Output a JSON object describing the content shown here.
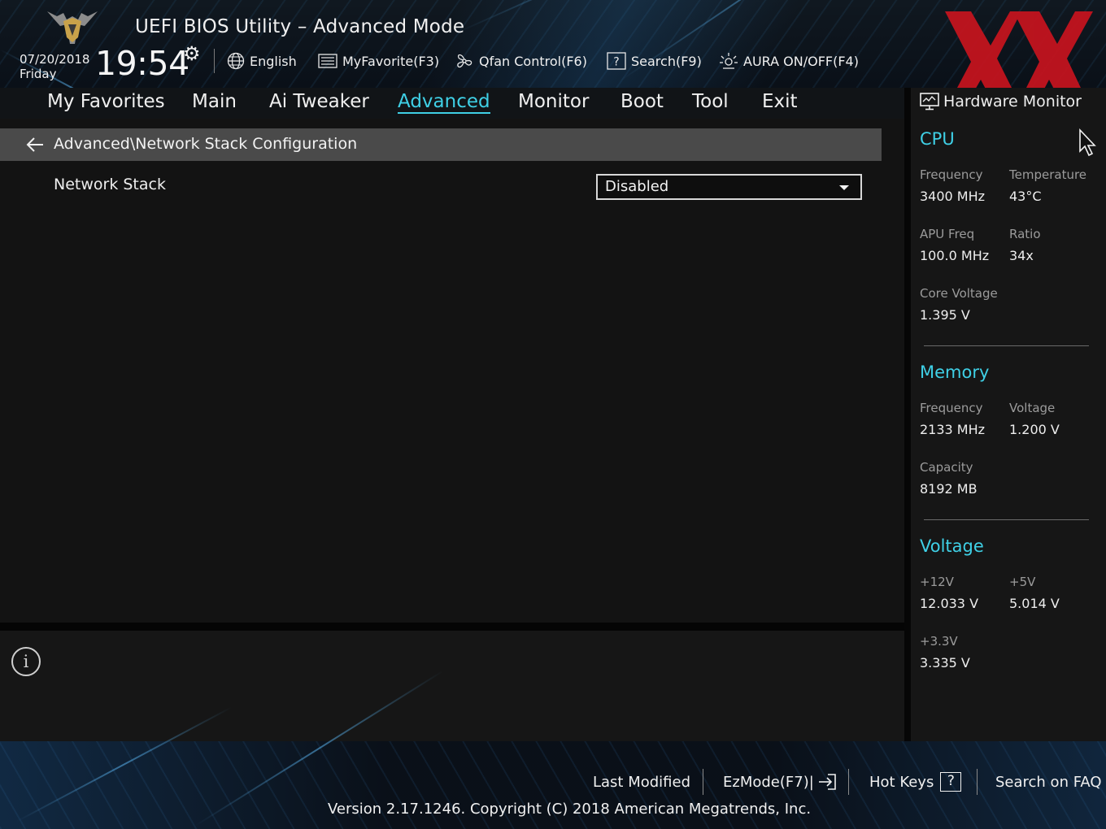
{
  "header": {
    "title": "UEFI BIOS Utility – Advanced Mode",
    "date": "07/20/2018",
    "day": "Friday",
    "time": "19:54",
    "toolbar": {
      "language": "English",
      "myfavorite": "MyFavorite(F3)",
      "qfan": "Qfan Control(F6)",
      "search": "Search(F9)",
      "aura": "AURA ON/OFF(F4)"
    }
  },
  "nav": {
    "tabs": [
      "My Favorites",
      "Main",
      "Ai Tweaker",
      "Advanced",
      "Monitor",
      "Boot",
      "Tool",
      "Exit"
    ],
    "active": "Advanced"
  },
  "main": {
    "breadcrumb": "Advanced\\Network Stack Configuration",
    "settings": [
      {
        "label": "Network Stack",
        "value": "Disabled"
      }
    ]
  },
  "hardware_monitor": {
    "title": "Hardware Monitor",
    "cpu": {
      "heading": "CPU",
      "frequency_label": "Frequency",
      "frequency": "3400 MHz",
      "temperature_label": "Temperature",
      "temperature": "43°C",
      "apu_freq_label": "APU Freq",
      "apu_freq": "100.0 MHz",
      "ratio_label": "Ratio",
      "ratio": "34x",
      "core_voltage_label": "Core Voltage",
      "core_voltage": "1.395 V"
    },
    "memory": {
      "heading": "Memory",
      "frequency_label": "Frequency",
      "frequency": "2133 MHz",
      "voltage_label": "Voltage",
      "voltage": "1.200 V",
      "capacity_label": "Capacity",
      "capacity": "8192 MB"
    },
    "voltage": {
      "heading": "Voltage",
      "v12_label": "+12V",
      "v12": "12.033 V",
      "v5_label": "+5V",
      "v5": "5.014 V",
      "v33_label": "+3.3V",
      "v33": "3.335 V"
    }
  },
  "footer": {
    "last_modified": "Last Modified",
    "ezmode": "EzMode(F7)|",
    "hotkeys": "Hot Keys",
    "hotkeys_box": "?",
    "faq": "Search on FAQ",
    "version": "Version 2.17.1246. Copyright (C) 2018 American Megatrends, Inc."
  },
  "colors": {
    "accent": "#3fd0e6",
    "brand_x": "#c8141e",
    "breadcrumb_bg": "#4a4a4a",
    "panel_bg": "#131313"
  },
  "icons": [
    "tuf-logo-icon",
    "gear-icon",
    "globe-icon",
    "favorite-list-icon",
    "fan-icon",
    "search-help-icon",
    "aura-icon",
    "back-arrow-icon",
    "dropdown-caret-icon",
    "info-icon",
    "monitor-icon",
    "mouse-cursor-icon",
    "exit-arrow-icon"
  ]
}
